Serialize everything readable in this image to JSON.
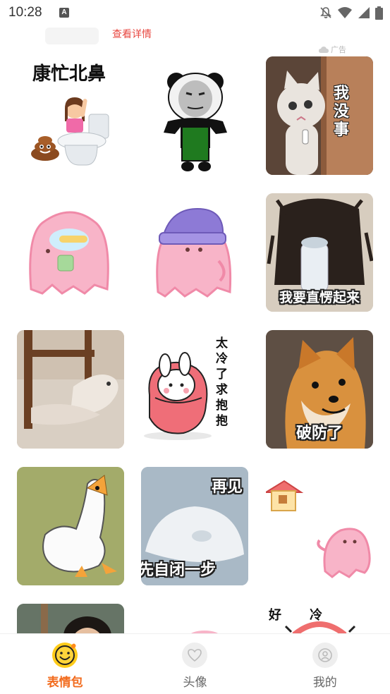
{
  "status": {
    "time": "10:28",
    "a_icon": "A",
    "icons": [
      "bell-off-icon",
      "wifi-icon",
      "signal-icon",
      "battery-icon"
    ]
  },
  "ad": {
    "link": "查看详情",
    "tag": "广告"
  },
  "tiles": [
    {
      "caption": "康忙北鼻"
    },
    {
      "caption": ""
    },
    {
      "caption": "我没事"
    },
    {
      "caption": ""
    },
    {
      "caption": ""
    },
    {
      "caption": "我要直愣起来"
    },
    {
      "caption": ""
    },
    {
      "caption": "太冷了求抱抱"
    },
    {
      "caption": "破防了"
    },
    {
      "caption": ""
    },
    {
      "caption": "再见",
      "caption2": "先自闭一步"
    },
    {
      "caption": ""
    },
    {
      "caption": ""
    },
    {
      "caption": ""
    },
    {
      "caption": "好冷"
    }
  ],
  "nav": [
    {
      "label": "表情包",
      "icon": "smiley-icon",
      "active": true
    },
    {
      "label": "头像",
      "icon": "heart-icon",
      "active": false
    },
    {
      "label": "我的",
      "icon": "user-icon",
      "active": false
    }
  ],
  "colors": {
    "accent": "#f26b1d",
    "ad_link": "#e8463f",
    "active_icon_bg": "#ffcc1a"
  }
}
